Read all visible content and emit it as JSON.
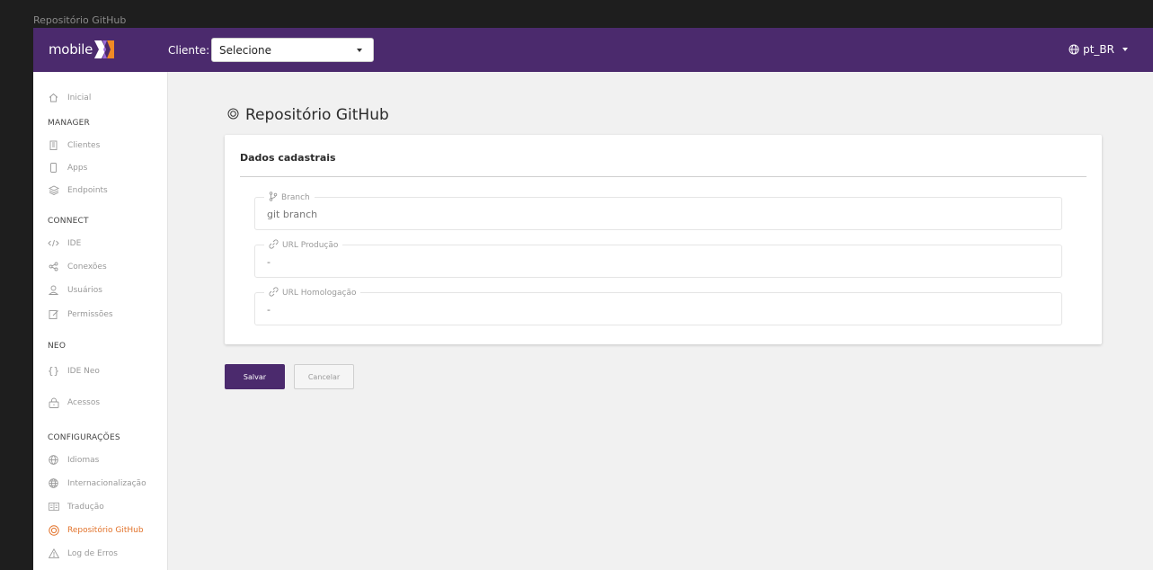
{
  "window": {
    "title": "Repositório GitHub"
  },
  "topbar": {
    "logo_text": "mobile",
    "client_label": "Cliente:",
    "client_select_value": "Selecione",
    "locale": "pt_BR",
    "colors": {
      "background": "#4b2a6d",
      "logo_x_left": "#9b6bd6",
      "logo_x_right": "#f08a24"
    }
  },
  "sidebar": {
    "home": {
      "label": "Inicial",
      "icon": "home-icon"
    },
    "sections": [
      {
        "title": "MANAGER",
        "items": [
          {
            "label": "Clientes",
            "icon": "building-icon"
          },
          {
            "label": "Apps",
            "icon": "phone-icon"
          },
          {
            "label": "Endpoints",
            "icon": "layers-icon"
          }
        ]
      },
      {
        "title": "CONNECT",
        "items": [
          {
            "label": "IDE",
            "icon": "code-icon"
          },
          {
            "label": "Conexões",
            "icon": "share-icon"
          },
          {
            "label": "Usuários",
            "icon": "user-icon"
          },
          {
            "label": "Permissões",
            "icon": "edit-icon"
          }
        ]
      },
      {
        "title": "NEO",
        "items": [
          {
            "label": "IDE Neo",
            "icon": "braces-icon"
          },
          {
            "label": "Acessos",
            "icon": "lock-icon"
          }
        ]
      },
      {
        "title": "CONFIGURAÇÕES",
        "items": [
          {
            "label": "Idiomas",
            "icon": "globe-icon"
          },
          {
            "label": "Internacionalização",
            "icon": "globe-icon"
          },
          {
            "label": "Tradução",
            "icon": "translate-icon"
          },
          {
            "label": "Repositório GitHub",
            "icon": "github-icon",
            "active": true
          },
          {
            "label": "Log de Erros",
            "icon": "warning-icon"
          }
        ]
      }
    ],
    "active_color": "#e2732b"
  },
  "main": {
    "title": "Repositório GitHub",
    "card_title": "Dados cadastrais",
    "fields": [
      {
        "label": "Branch",
        "value": "git branch",
        "icon": "branch-icon"
      },
      {
        "label": "URL Produção",
        "value": "-",
        "icon": "link-icon"
      },
      {
        "label": "URL Homologação",
        "value": "-",
        "icon": "link-icon"
      }
    ],
    "save_label": "Salvar",
    "cancel_label": "Cancelar"
  }
}
